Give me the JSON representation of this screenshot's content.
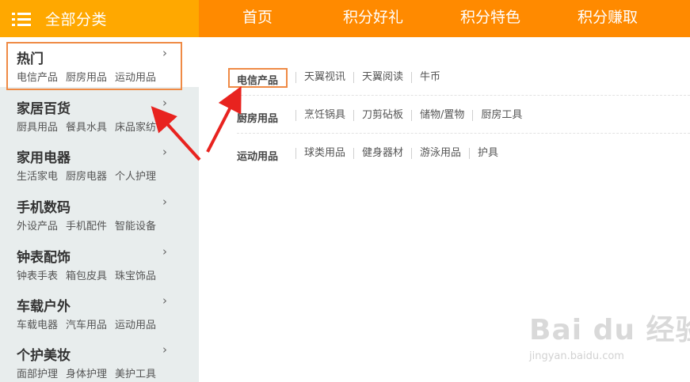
{
  "header": {
    "category_title": "全部分类",
    "menu_icon": "list-menu-icon",
    "nav": [
      "首页",
      "积分好礼",
      "积分特色",
      "积分赚取"
    ]
  },
  "sidebar": {
    "categories": [
      {
        "name": "热门",
        "subs": [
          "电信产品",
          "厨房用品",
          "运动用品"
        ]
      },
      {
        "name": "家居百货",
        "subs": [
          "厨具用品",
          "餐具水具",
          "床品家纺"
        ]
      },
      {
        "name": "家用电器",
        "subs": [
          "生活家电",
          "厨房电器",
          "个人护理"
        ]
      },
      {
        "name": "手机数码",
        "subs": [
          "外设产品",
          "手机配件",
          "智能设备"
        ]
      },
      {
        "name": "钟表配饰",
        "subs": [
          "钟表手表",
          "箱包皮具",
          "珠宝饰品"
        ]
      },
      {
        "name": "车载户外",
        "subs": [
          "车载电器",
          "汽车用品",
          "运动用品"
        ]
      },
      {
        "name": "个护美妆",
        "subs": [
          "面部护理",
          "身体护理",
          "美护工具"
        ]
      }
    ],
    "arrow_glyph": "›"
  },
  "panel": {
    "rows": [
      {
        "label": "电信产品",
        "items": [
          "天翼视讯",
          "天翼阅读",
          "牛币"
        ]
      },
      {
        "label": "厨房用品",
        "items": [
          "烹饪锅具",
          "刀剪砧板",
          "储物/置物",
          "厨房工具"
        ]
      },
      {
        "label": "运动用品",
        "items": [
          "球类用品",
          "健身器材",
          "游泳用品",
          "护具"
        ]
      }
    ]
  },
  "watermark": {
    "logo": "Bai du 经验",
    "url": "jingyan.baidu.com"
  },
  "colors": {
    "nav_bar": "#ff8a00",
    "category_header": "#ffa800",
    "sidebar_bg": "#e8eded",
    "highlight_box": "#ef8a45",
    "arrow": "#e8231f"
  }
}
